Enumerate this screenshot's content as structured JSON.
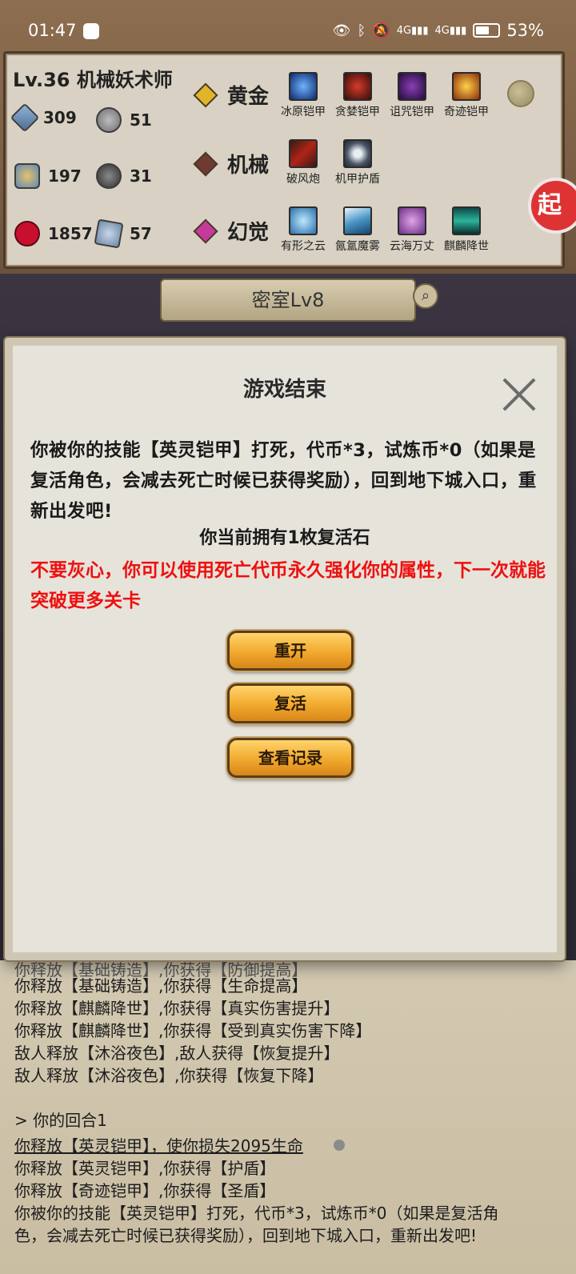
{
  "status_bar": {
    "time": "01:47",
    "battery": "53%"
  },
  "character": {
    "title": "Lv.36 机械妖术师",
    "stats": {
      "attack": "309",
      "attack_res": "51",
      "defense": "197",
      "defense_res": "31",
      "hp": "1857",
      "hp_res": "57"
    }
  },
  "factions": [
    {
      "name": "黄金",
      "color": "#e1b52b",
      "skills": [
        "冰原铠甲",
        "贪婪铠甲",
        "诅咒铠甲",
        "奇迹铠甲"
      ]
    },
    {
      "name": "机械",
      "color": "#6e3a32",
      "skills": [
        "破风炮",
        "机甲护盾"
      ]
    },
    {
      "name": "幻觉",
      "color": "#c53a9a",
      "skills": [
        "有形之云",
        "氤氲魔雾",
        "云海万丈",
        "麒麟降世"
      ]
    }
  ],
  "side_button": {
    "label": "起"
  },
  "room": {
    "title": "密室Lv8"
  },
  "modal": {
    "title": "游戏结束",
    "message": "你被你的技能【英灵铠甲】打死，代币*3，试炼币*0（如果是复活角色，会减去死亡时候已获得奖励），回到地下城入口，重新出发吧!",
    "stones": "你当前拥有1枚复活石",
    "hint": "不要灰心，你可以使用死亡代币永久强化你的属性，下一次就能突破更多关卡",
    "buttons": {
      "restart": "重开",
      "revive": "复活",
      "records": "查看记录"
    }
  },
  "log": {
    "partial": "你释放【基础铸造】,你获得【防御提高】",
    "lines": [
      "你释放【基础铸造】,你获得【生命提高】",
      "你释放【麒麟降世】,你获得【真实伤害提升】",
      "你释放【麒麟降世】,你获得【受到真实伤害下降】",
      "敌人释放【沐浴夜色】,敌人获得【恢复提升】",
      "敌人释放【沐浴夜色】,你获得【恢复下降】"
    ],
    "turn": "> 你的回合1",
    "turn_lines": [
      "你释放【英灵铠甲】，使你损失2095生命",
      "你释放【英灵铠甲】,你获得【护盾】",
      "你释放【奇迹铠甲】,你获得【圣盾】",
      "你被你的技能【英灵铠甲】打死，代币*3，试炼币*0（如果是复活角",
      "色，会减去死亡时候已获得奖励），回到地下城入口，重新出发吧!"
    ]
  }
}
